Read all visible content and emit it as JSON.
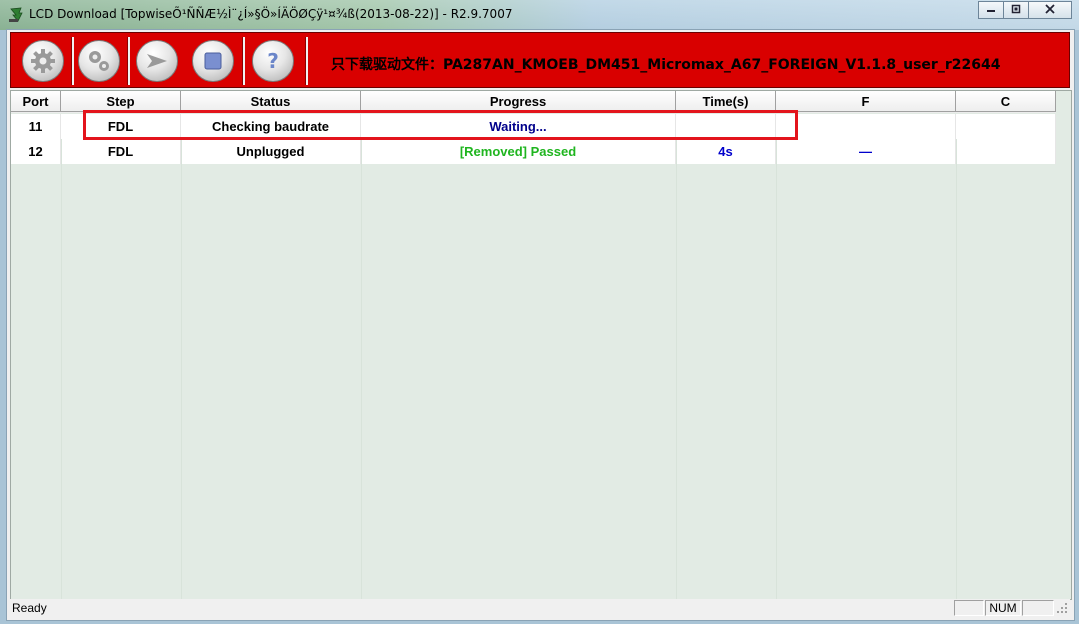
{
  "window": {
    "title": "LCD Download [TopwiseÕ¹ÑÑÆ½Ì¨¿Í»§Ö»ÍÄÖØÇÿ¹¤¾ß(2013-08-22)] - R2.9.7007",
    "controls": {
      "minimize": "▭",
      "maximize": "▢",
      "close": "✕"
    }
  },
  "toolbar": {
    "buttons": [
      {
        "name": "load-settings-button",
        "icon": "gear-icon"
      },
      {
        "name": "configure-button",
        "icon": "gears-icon"
      },
      {
        "name": "start-button",
        "icon": "play-arrow-icon"
      },
      {
        "name": "stop-button",
        "icon": "stop-square-icon"
      },
      {
        "name": "help-button",
        "icon": "question-icon"
      }
    ],
    "info_text": "只下载驱动文件：PA287AN_KMOEB_DM451_Micromax_A67_FOREIGN_V1.1.8_user_r22644",
    "color": "#d90000"
  },
  "grid": {
    "columns": [
      "Port",
      "Step",
      "Status",
      "Progress",
      "Time(s)",
      "F",
      "C"
    ],
    "rows": [
      {
        "port": "11",
        "step": "FDL",
        "status": "Checking baudrate",
        "progress": "Waiting...",
        "time": "",
        "f": "",
        "c": ""
      },
      {
        "port": "12",
        "step": "FDL",
        "status": "Unplugged",
        "progress": "[Removed] Passed",
        "time": "4s",
        "f": "—",
        "c": ""
      }
    ],
    "colors": {
      "waiting": "#00008b",
      "passed": "#1fb51f",
      "time": "#0000cc",
      "highlight": "#e3141c",
      "background": "#e2ebe4"
    }
  },
  "statusbar": {
    "text": "Ready",
    "num": "NUM"
  }
}
